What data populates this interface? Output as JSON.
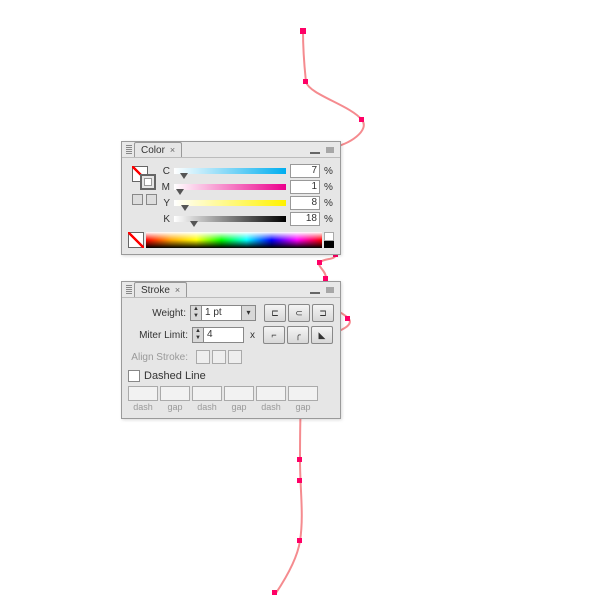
{
  "colorPanel": {
    "title": "Color",
    "channels": {
      "c": {
        "label": "C",
        "value": "7",
        "pct": "%"
      },
      "m": {
        "label": "M",
        "value": "1",
        "pct": "%"
      },
      "y": {
        "label": "Y",
        "value": "8",
        "pct": "%"
      },
      "k": {
        "label": "K",
        "value": "18",
        "pct": "%"
      }
    }
  },
  "strokePanel": {
    "title": "Stroke",
    "weightLabel": "Weight:",
    "weightValue": "1 pt",
    "miterLabel": "Miter Limit:",
    "miterValue": "4",
    "miterSuffix": "x",
    "alignLabel": "Align Stroke:",
    "dashedLabel": "Dashed Line",
    "dashCols": [
      {
        "label": "dash"
      },
      {
        "label": "gap"
      },
      {
        "label": "dash"
      },
      {
        "label": "gap"
      },
      {
        "label": "dash"
      },
      {
        "label": "gap"
      }
    ]
  },
  "pathColor": "#f58b8f"
}
